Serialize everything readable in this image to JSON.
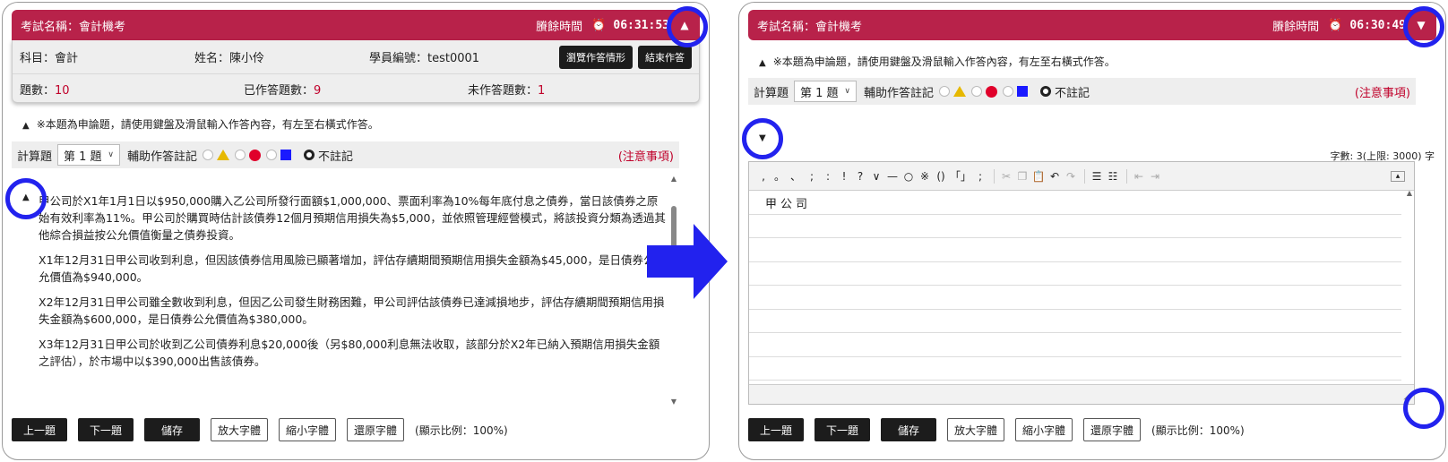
{
  "left": {
    "exam_title": "考試名稱：會計機考",
    "remaining_label": "賸餘時間",
    "time": "06:31:53",
    "subject": "科目：會計",
    "name": "姓名：陳小伶",
    "student_id": "學員編號：test0001",
    "browse_button": "瀏覽作答情形",
    "end_button": "結束作答",
    "total_label": "題數：",
    "total_value": "10",
    "answered_label": "已作答題數：",
    "answered_value": "9",
    "unanswered_label": "未作答題數：",
    "unanswered_value": "1",
    "notice": "※本題為申論題，請使用鍵盤及滑鼠輸入作答內容，有左至右橫式作答。",
    "question_type": "計算題",
    "question_select": "第 1 題",
    "mark_label": "輔助作答註記",
    "no_mark_label": "不註記",
    "attention": "(注意事項)",
    "paragraphs": [
      "甲公司於X1年1月1日以$950,000購入乙公司所發行面額$1,000,000、票面利率為10%每年底付息之債券，當日該債券之原始有效利率為11%。甲公司於購買時估計該債券12個月預期信用損失為$5,000，並依照管理經營模式，將該投資分類為透過其他綜合損益按公允價值衡量之債券投資。",
      "X1年12月31日甲公司收到利息，但因該債券信用風險已顯著增加，評估存續期間預期信用損失金額為$45,000，是日債券公允價值為$940,000。",
      "X2年12月31日甲公司雖全數收到利息，但因乙公司發生財務困難，甲公司評估該債券已達減損地步，評估存續期間預期信用損失金額為$600,000，是日債券公允價值為$380,000。",
      "X3年12月31日甲公司於收到乙公司債券利息$20,000後（另$80,000利息無法收取，該部分於X2年已納入預期信用損失金額之評估），於市場中以$390,000出售該債券。"
    ],
    "buttons": {
      "prev": "上一題",
      "next": "下一題",
      "save": "儲存",
      "enlarge": "放大字體",
      "shrink": "縮小字體",
      "reset": "還原字體",
      "ratio": "(顯示比例：100%)"
    }
  },
  "right": {
    "exam_title": "考試名稱：會計機考",
    "remaining_label": "賸餘時間",
    "time": "06:30:49",
    "notice": "※本題為申論題，請使用鍵盤及滑鼠輸入作答內容，有左至右橫式作答。",
    "question_type": "計算題",
    "question_select": "第 1 題",
    "mark_label": "輔助作答註記",
    "no_mark_label": "不註記",
    "attention": "(注意事項)",
    "word_count": "字數: 3(上限: 3000) 字",
    "answer_text": "甲公司",
    "editor_tools": [
      ",",
      "。",
      "、",
      ";",
      ":",
      "!",
      "?",
      "∨",
      "—",
      "○",
      "※",
      "()",
      "「」",
      ";"
    ],
    "buttons": {
      "prev": "上一題",
      "next": "下一題",
      "save": "儲存",
      "enlarge": "放大字體",
      "shrink": "縮小字體",
      "reset": "還原字體",
      "ratio": "(顯示比例：100%)"
    }
  },
  "colors": {
    "header": "#b8224a",
    "highlight": "#2222ee",
    "accent_red": "#c0002a"
  }
}
